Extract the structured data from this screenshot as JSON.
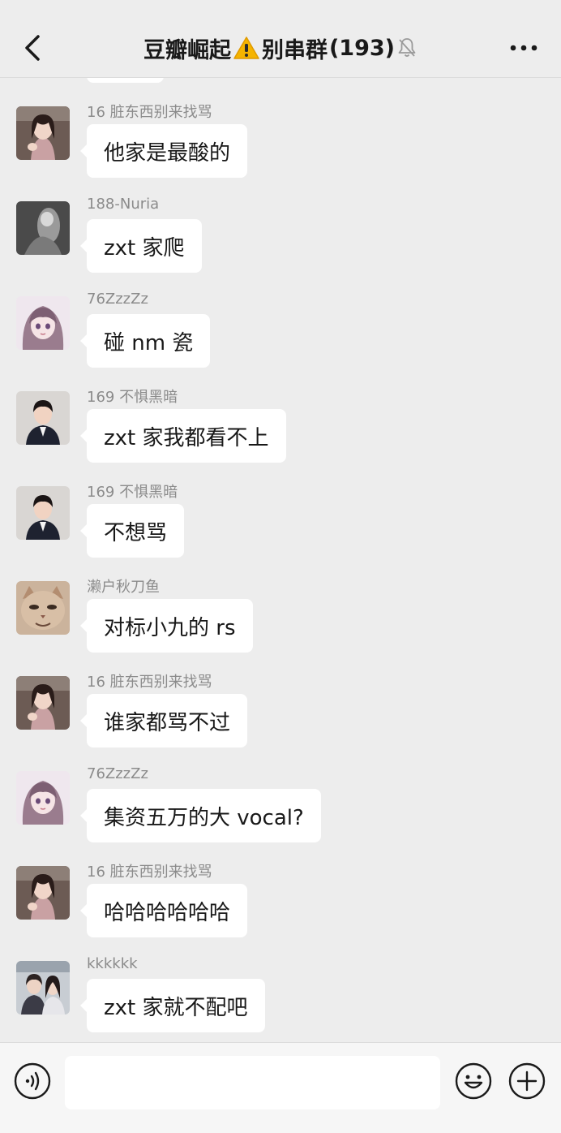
{
  "header": {
    "title_text": "豆瓣崛起",
    "title_suffix": "别串群",
    "member_count": "(193)",
    "back_icon": "chevron-left-icon",
    "warning_icon": "warning-icon",
    "mute_icon": "bell-muted-icon",
    "more_icon": "more-dots-icon"
  },
  "messages": [
    {
      "sender": "16 脏东西别来找骂",
      "text": "他家是最酸的",
      "avatar": "girl-avatar-a"
    },
    {
      "sender": "188-Nuria",
      "text": "zxt 家爬",
      "avatar": "grayscale-avatar"
    },
    {
      "sender": "76ZzzZz",
      "text": "碰 nm 瓷",
      "avatar": "anime-girl-avatar"
    },
    {
      "sender": "169 不惧黑暗",
      "text": "zxt 家我都看不上",
      "avatar": "man-suit-avatar"
    },
    {
      "sender": "169 不惧黑暗",
      "text": "不想骂",
      "avatar": "man-suit-avatar"
    },
    {
      "sender": "濑户秋刀鱼",
      "text": "对标小九的 rs",
      "avatar": "cat-avatar"
    },
    {
      "sender": "16 脏东西别来找骂",
      "text": "谁家都骂不过",
      "avatar": "girl-avatar-a"
    },
    {
      "sender": "76ZzzZz",
      "text": "集资五万的大 vocal?",
      "avatar": "anime-girl-avatar"
    },
    {
      "sender": "16 脏东西别来找骂",
      "text": "哈哈哈哈哈哈",
      "avatar": "girl-avatar-a"
    },
    {
      "sender": "kkkkkk",
      "text": "zxt 家就不配吧",
      "avatar": "two-people-avatar"
    }
  ],
  "input_bar": {
    "placeholder": "",
    "voice_icon": "voice-icon",
    "emoji_icon": "emoji-icon",
    "plus_icon": "plus-icon"
  },
  "colors": {
    "background": "#ededed",
    "bubble": "#ffffff",
    "sender_text": "#8b8b8b",
    "message_text": "#181818",
    "warning": "#f5b400"
  }
}
